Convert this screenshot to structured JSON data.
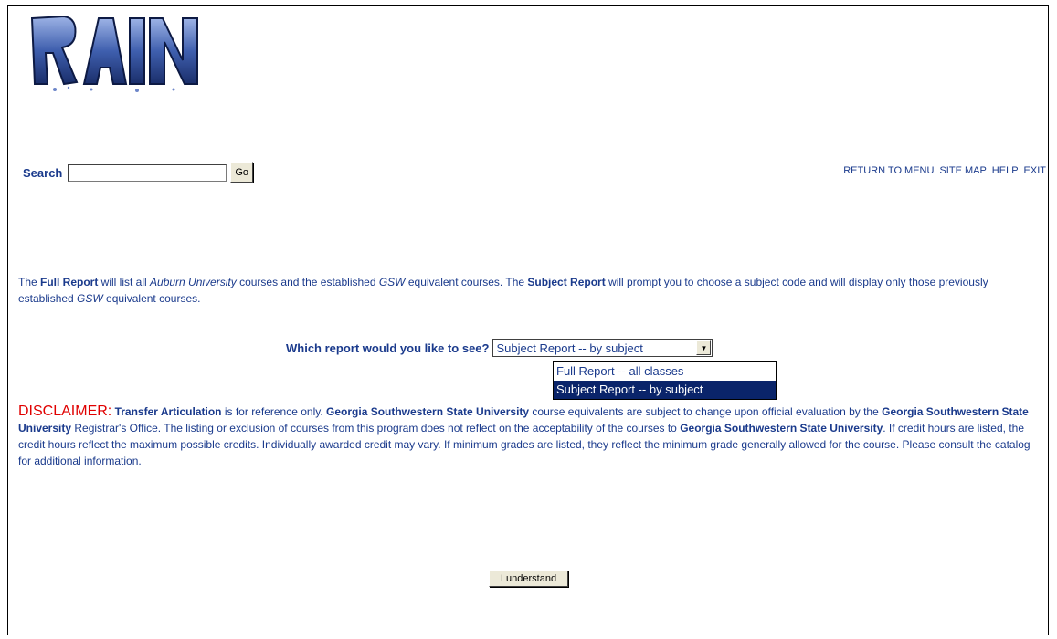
{
  "logo": {
    "text": "RAIN"
  },
  "search": {
    "label": "Search",
    "value": "",
    "button_label": "Go"
  },
  "nav": {
    "return_to_menu": "RETURN TO MENU",
    "site_map": "SITE MAP",
    "help": "HELP",
    "exit": "EXIT"
  },
  "intro": {
    "p1": "The ",
    "full_report": "Full Report",
    "p2": " will list all ",
    "auburn": "Auburn University",
    "p3": " courses and the established ",
    "gsw1": "GSW",
    "p4": " equivalent courses. The ",
    "subject_report": "Subject Report",
    "p5": " will prompt you to choose a subject code and will display only those previously established ",
    "gsw2": "GSW",
    "p6": " equivalent courses."
  },
  "report": {
    "label": "Which report would you like to see?",
    "selected": "Subject Report -- by subject",
    "options": [
      "Full Report -- all classes",
      "Subject Report -- by subject"
    ]
  },
  "disclaimer": {
    "heading": "DISCLAIMER:",
    "b1": "Transfer Articulation",
    "t1": " is for reference only. ",
    "b2": "Georgia Southwestern State University",
    "t2": " course equivalents are subject to change upon official evaluation by the ",
    "b3": "Georgia Southwestern State University",
    "t3": " Registrar's Office. The listing or exclusion of courses from this program does not reflect on the acceptability of the courses to ",
    "b4": "Georgia Southwestern State University",
    "t4": ". If credit hours are listed, the credit hours reflect the maximum possible credits. Individually awarded credit may vary. If minimum grades are listed, they reflect the minimum grade generally allowed for the course. Please consult the catalog for additional information."
  },
  "understand_label": "I understand",
  "colors": {
    "text": "#1a3a8c",
    "disclaimer": "#e00000",
    "selection": "#0a246a"
  }
}
